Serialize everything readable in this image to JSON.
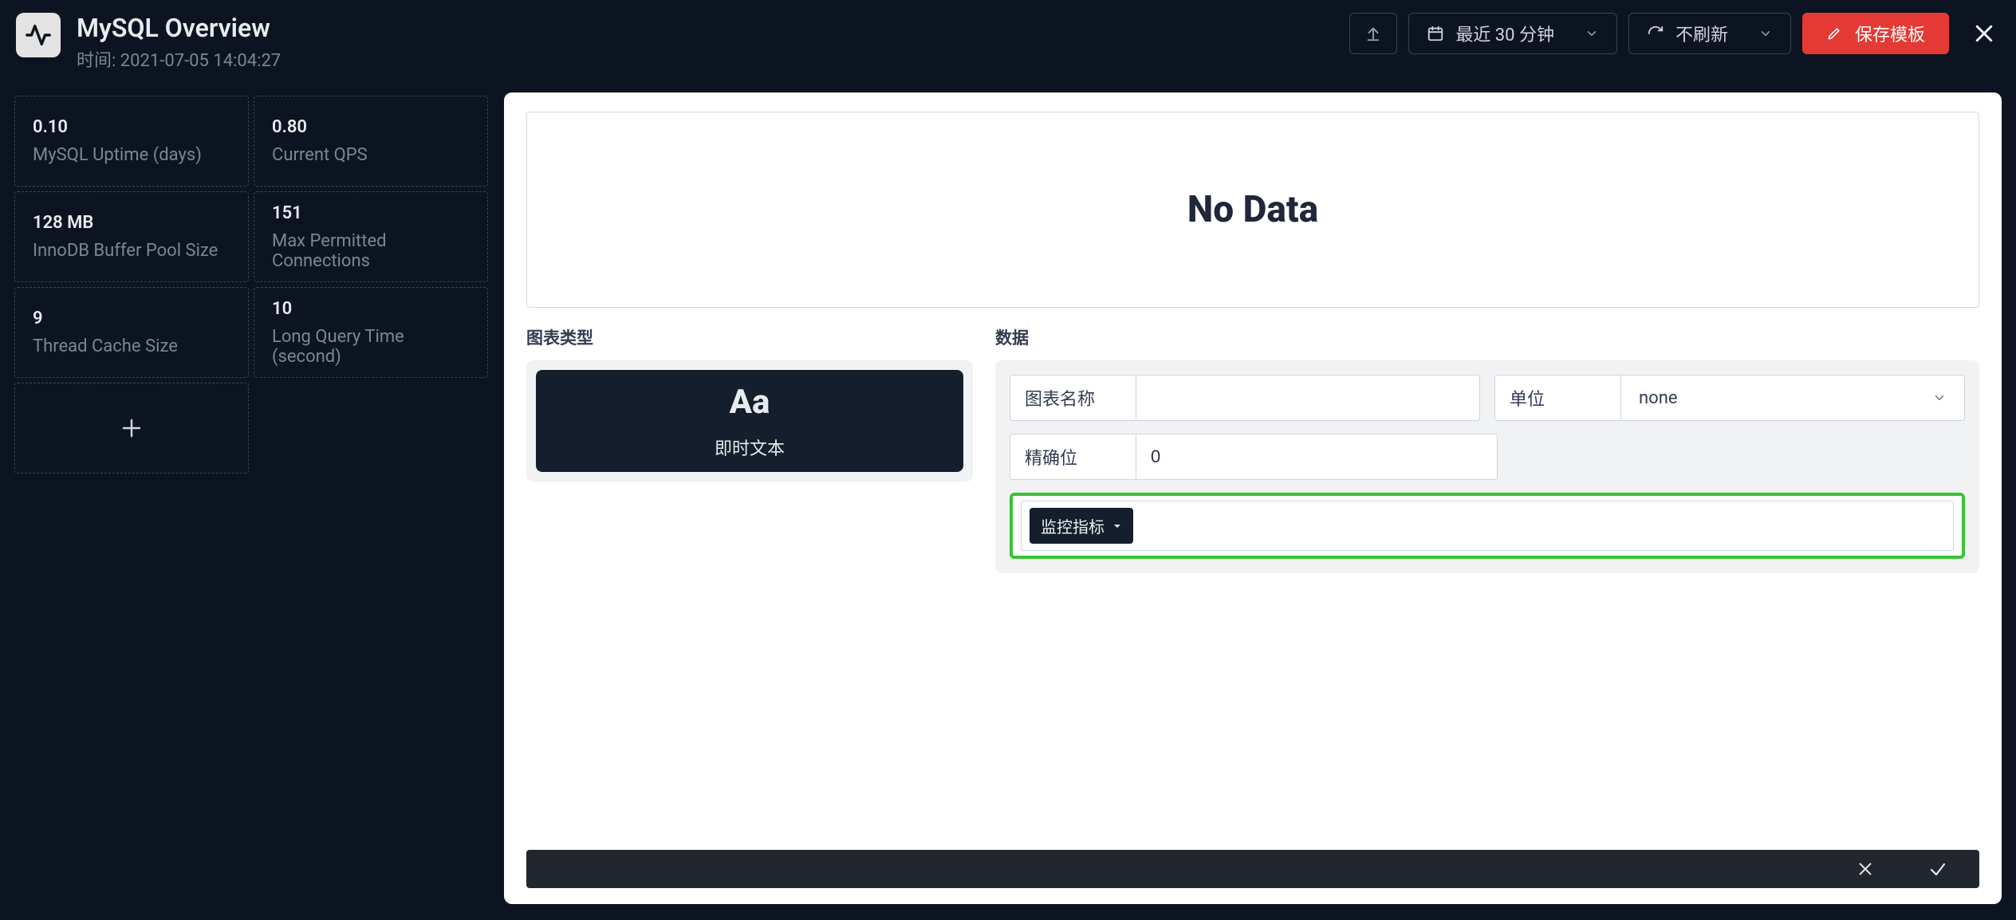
{
  "header": {
    "title": "MySQL Overview",
    "timestamp_prefix": "时间: ",
    "timestamp": "2021-07-05 14:04:27",
    "timerange_label": "最近 30 分钟",
    "refresh_label": "不刷新",
    "save_label": "保存模板"
  },
  "tiles": [
    {
      "value": "0.10",
      "label": "MySQL Uptime (days)"
    },
    {
      "value": "0.80",
      "label": "Current QPS"
    },
    {
      "value": "128 MB",
      "label": "InnoDB Buffer Pool Size"
    },
    {
      "value": "151",
      "label": "Max Permitted Connections"
    },
    {
      "value": "9",
      "label": "Thread Cache Size"
    },
    {
      "value": "10",
      "label": "Long Query Time (second)"
    }
  ],
  "editor": {
    "no_data": "No Data",
    "section_chart_type": "图表类型",
    "section_data": "数据",
    "chart_type_option": {
      "symbol": "Aa",
      "label": "即时文本"
    },
    "form": {
      "chart_name_label": "图表名称",
      "chart_name_value": "",
      "unit_label": "单位",
      "unit_value": "none",
      "precision_label": "精确位",
      "precision_value": "0",
      "metric_chip": "监控指标"
    }
  }
}
